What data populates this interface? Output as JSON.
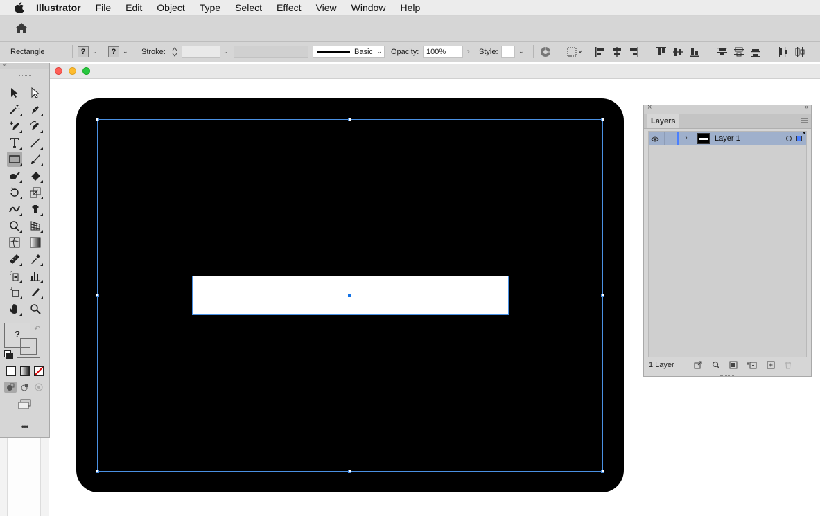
{
  "menu_bar": {
    "app_name": "Illustrator",
    "items": [
      "File",
      "Edit",
      "Object",
      "Type",
      "Select",
      "Effect",
      "View",
      "Window",
      "Help"
    ]
  },
  "control_bar": {
    "selection_label": "Rectangle",
    "fill_value": "?",
    "stroke_value": "?",
    "stroke_label": "Stroke:",
    "brush_label": "Basic",
    "opacity_label": "Opacity:",
    "opacity_value": "100%",
    "style_label": "Style:"
  },
  "tools_panel": {
    "fill_stroke_value": "?",
    "more_label": "•••"
  },
  "layers_panel": {
    "tab_label": "Layers",
    "layer_name": "Layer 1",
    "layer_count": "1 Layer"
  },
  "colors": {
    "accent": "#4a90e2",
    "artboard": "#000000",
    "selected_layer_row": "#9fb0cc"
  }
}
